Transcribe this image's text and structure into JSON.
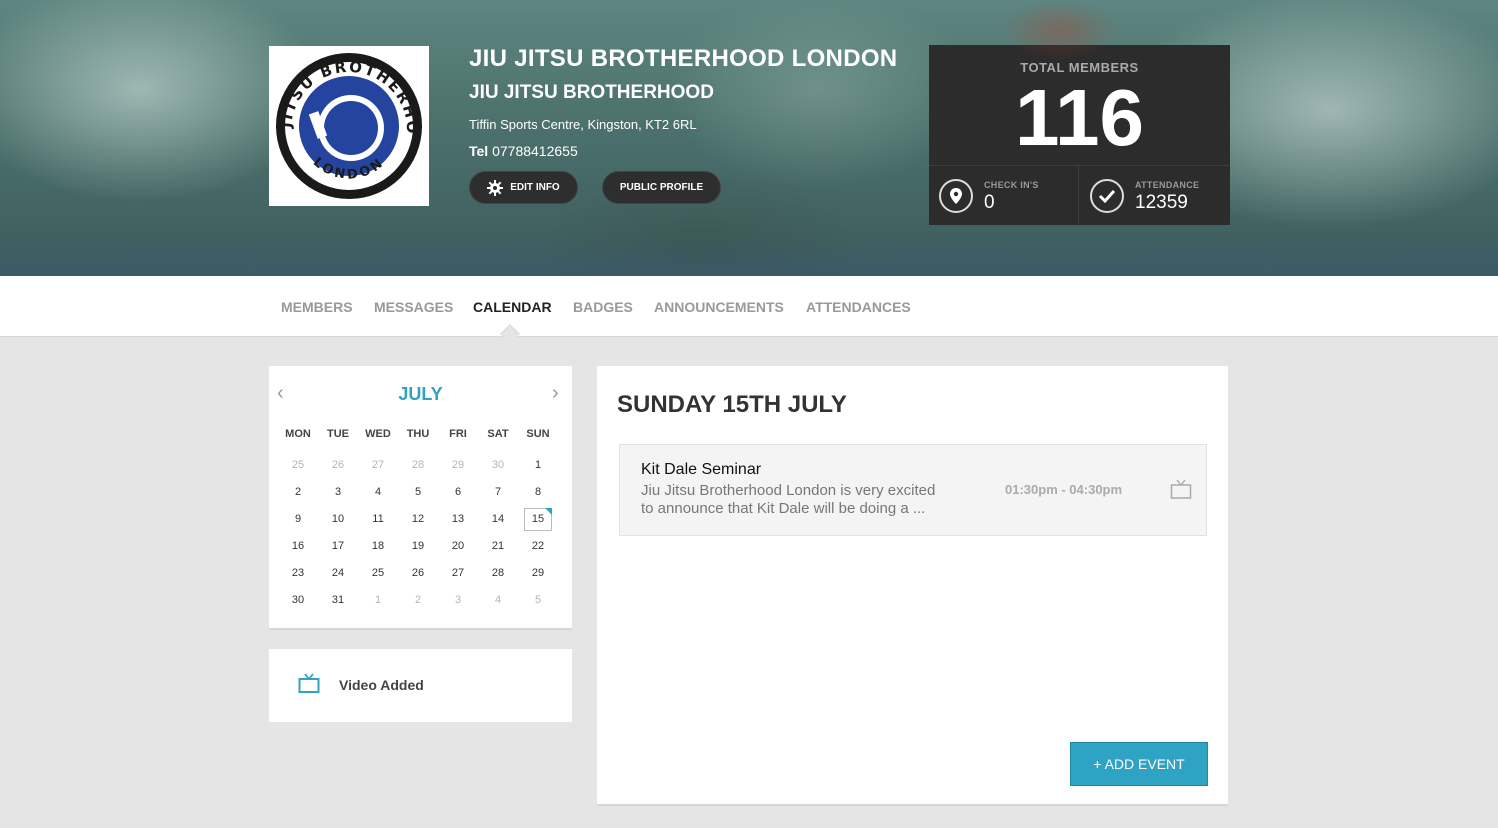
{
  "club": {
    "name": "JIU JITSU BROTHERHOOD LONDON",
    "subtitle": "JIU JITSU BROTHERHOOD",
    "address": "Tiffin Sports Centre, Kingston, KT2 6RL",
    "tel_label": "Tel",
    "tel_number": "07788412655",
    "logo_text_top": "JIU JITSU BROTHERHOOD",
    "logo_text_bottom": "LONDON"
  },
  "buttons": {
    "edit_info": "EDIT INFO",
    "public_profile": "PUBLIC PROFILE",
    "add_event": "+ ADD EVENT"
  },
  "stats": {
    "total_members_label": "TOTAL MEMBERS",
    "total_members": "116",
    "check_ins_label": "CHECK IN'S",
    "check_ins": "0",
    "attendance_label": "ATTENDANCE",
    "attendance": "12359"
  },
  "nav": {
    "members": "MEMBERS",
    "messages": "MESSAGES",
    "calendar": "CALENDAR",
    "badges": "BADGES",
    "announcements": "ANNOUNCEMENTS",
    "attendances": "ATTENDANCES",
    "active": "CALENDAR"
  },
  "calendar": {
    "month": "JULY",
    "weekdays": [
      "MON",
      "TUE",
      "WED",
      "THU",
      "FRI",
      "SAT",
      "SUN"
    ],
    "weeks": [
      [
        "25",
        "26",
        "27",
        "28",
        "29",
        "30",
        "1"
      ],
      [
        "2",
        "3",
        "4",
        "5",
        "6",
        "7",
        "8"
      ],
      [
        "9",
        "10",
        "11",
        "12",
        "13",
        "14",
        "15"
      ],
      [
        "16",
        "17",
        "18",
        "19",
        "20",
        "21",
        "22"
      ],
      [
        "23",
        "24",
        "25",
        "26",
        "27",
        "28",
        "29"
      ],
      [
        "30",
        "31",
        "1",
        "2",
        "3",
        "4",
        "5"
      ]
    ],
    "selected_day": "15",
    "accent_color": "#2fa3c4"
  },
  "legend": {
    "label": "Video Added",
    "icon": "tv-icon"
  },
  "day_view": {
    "title": "SUNDAY 15TH JULY",
    "events": [
      {
        "title": "Kit Dale Seminar",
        "description": "Jiu Jitsu Brotherhood London is very excited to announce that Kit Dale will be doing a ...",
        "time": "01:30pm - 04:30pm",
        "icon": "tv-icon"
      }
    ]
  }
}
